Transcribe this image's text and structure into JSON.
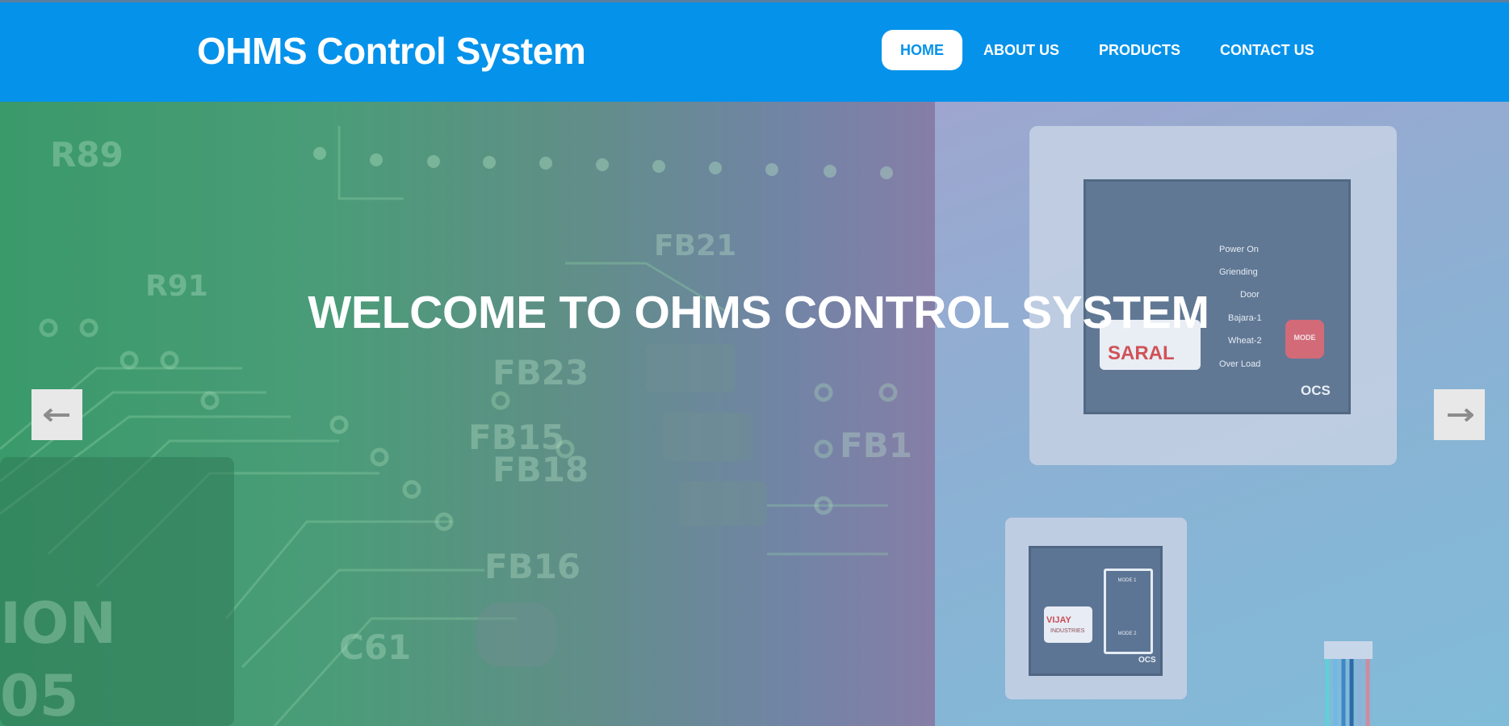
{
  "header": {
    "brand": "OHMS Control System",
    "menu": [
      {
        "label": "HOME",
        "active": true
      },
      {
        "label": "ABOUT US",
        "active": false
      },
      {
        "label": "PRODUCTS",
        "active": false
      },
      {
        "label": "CONTACT US",
        "active": false
      }
    ]
  },
  "hero": {
    "headline": "WELCOME TO OHMS CONTROL SYSTEM",
    "prev_icon": "arrow-left-icon",
    "next_icon": "arrow-right-icon",
    "left_image": {
      "circuit_labels": [
        "R89",
        "R91",
        "FB21",
        "FB23",
        "FB15",
        "FB18",
        "FB1",
        "FB16",
        "C61",
        "ION",
        "05"
      ]
    },
    "right_image": {
      "panel_labels": [
        "Power On",
        "Griending",
        "Door",
        "Bajara-1",
        "Wheat-2",
        "Over Load"
      ],
      "logo": "SARAL",
      "mode_button": "MODE",
      "ocs": "OCS",
      "second_logo": "VIJAY",
      "second_logo_sub": "INDUSTRIES",
      "switch_top": "MODE 1",
      "switch_bottom": "MODE 2",
      "ocs2": "OCS"
    }
  },
  "colors": {
    "navbar": "#0592ea",
    "active_item_text": "#0592ea",
    "white": "#ffffff",
    "arrow_bg": "#e8e8e8",
    "arrow_glyph": "#8c8c8c"
  }
}
